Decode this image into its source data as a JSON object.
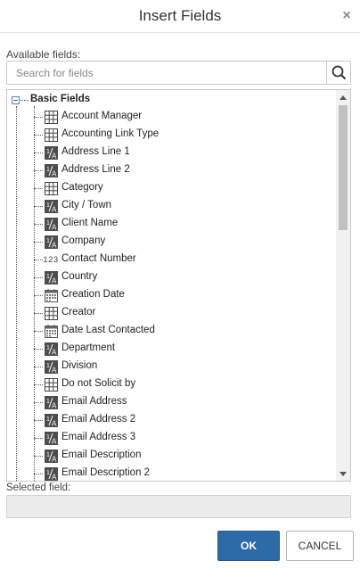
{
  "dialog": {
    "title": "Insert Fields",
    "close_glyph": "×"
  },
  "available_label": "Available fields:",
  "search": {
    "placeholder": "Search for fields",
    "value": "",
    "icon": "search-icon"
  },
  "tree": {
    "root_label": "Basic Fields",
    "root_expanded": true,
    "fields": [
      {
        "label": "Account Manager",
        "type": "grid"
      },
      {
        "label": "Accounting Link Type",
        "type": "grid"
      },
      {
        "label": "Address Line 1",
        "type": "text"
      },
      {
        "label": "Address Line 2",
        "type": "text"
      },
      {
        "label": "Category",
        "type": "grid"
      },
      {
        "label": "City / Town",
        "type": "text"
      },
      {
        "label": "Client Name",
        "type": "text"
      },
      {
        "label": "Company",
        "type": "text"
      },
      {
        "label": "Contact Number",
        "type": "number"
      },
      {
        "label": "Country",
        "type": "text"
      },
      {
        "label": "Creation Date",
        "type": "date"
      },
      {
        "label": "Creator",
        "type": "grid"
      },
      {
        "label": "Date Last Contacted",
        "type": "date"
      },
      {
        "label": "Department",
        "type": "text"
      },
      {
        "label": "Division",
        "type": "text"
      },
      {
        "label": "Do not Solicit by",
        "type": "grid"
      },
      {
        "label": "Email Address",
        "type": "text"
      },
      {
        "label": "Email Address 2",
        "type": "text"
      },
      {
        "label": "Email Address 3",
        "type": "text"
      },
      {
        "label": "Email Description",
        "type": "text"
      },
      {
        "label": "Email Description 2",
        "type": "text"
      }
    ],
    "number_icon_text": "123"
  },
  "selected": {
    "label": "Selected field:",
    "value": ""
  },
  "buttons": {
    "ok": "OK",
    "cancel": "CANCEL"
  },
  "colors": {
    "ok_bg": "#2c6aa8",
    "text_icon": "#4d4d4d"
  }
}
